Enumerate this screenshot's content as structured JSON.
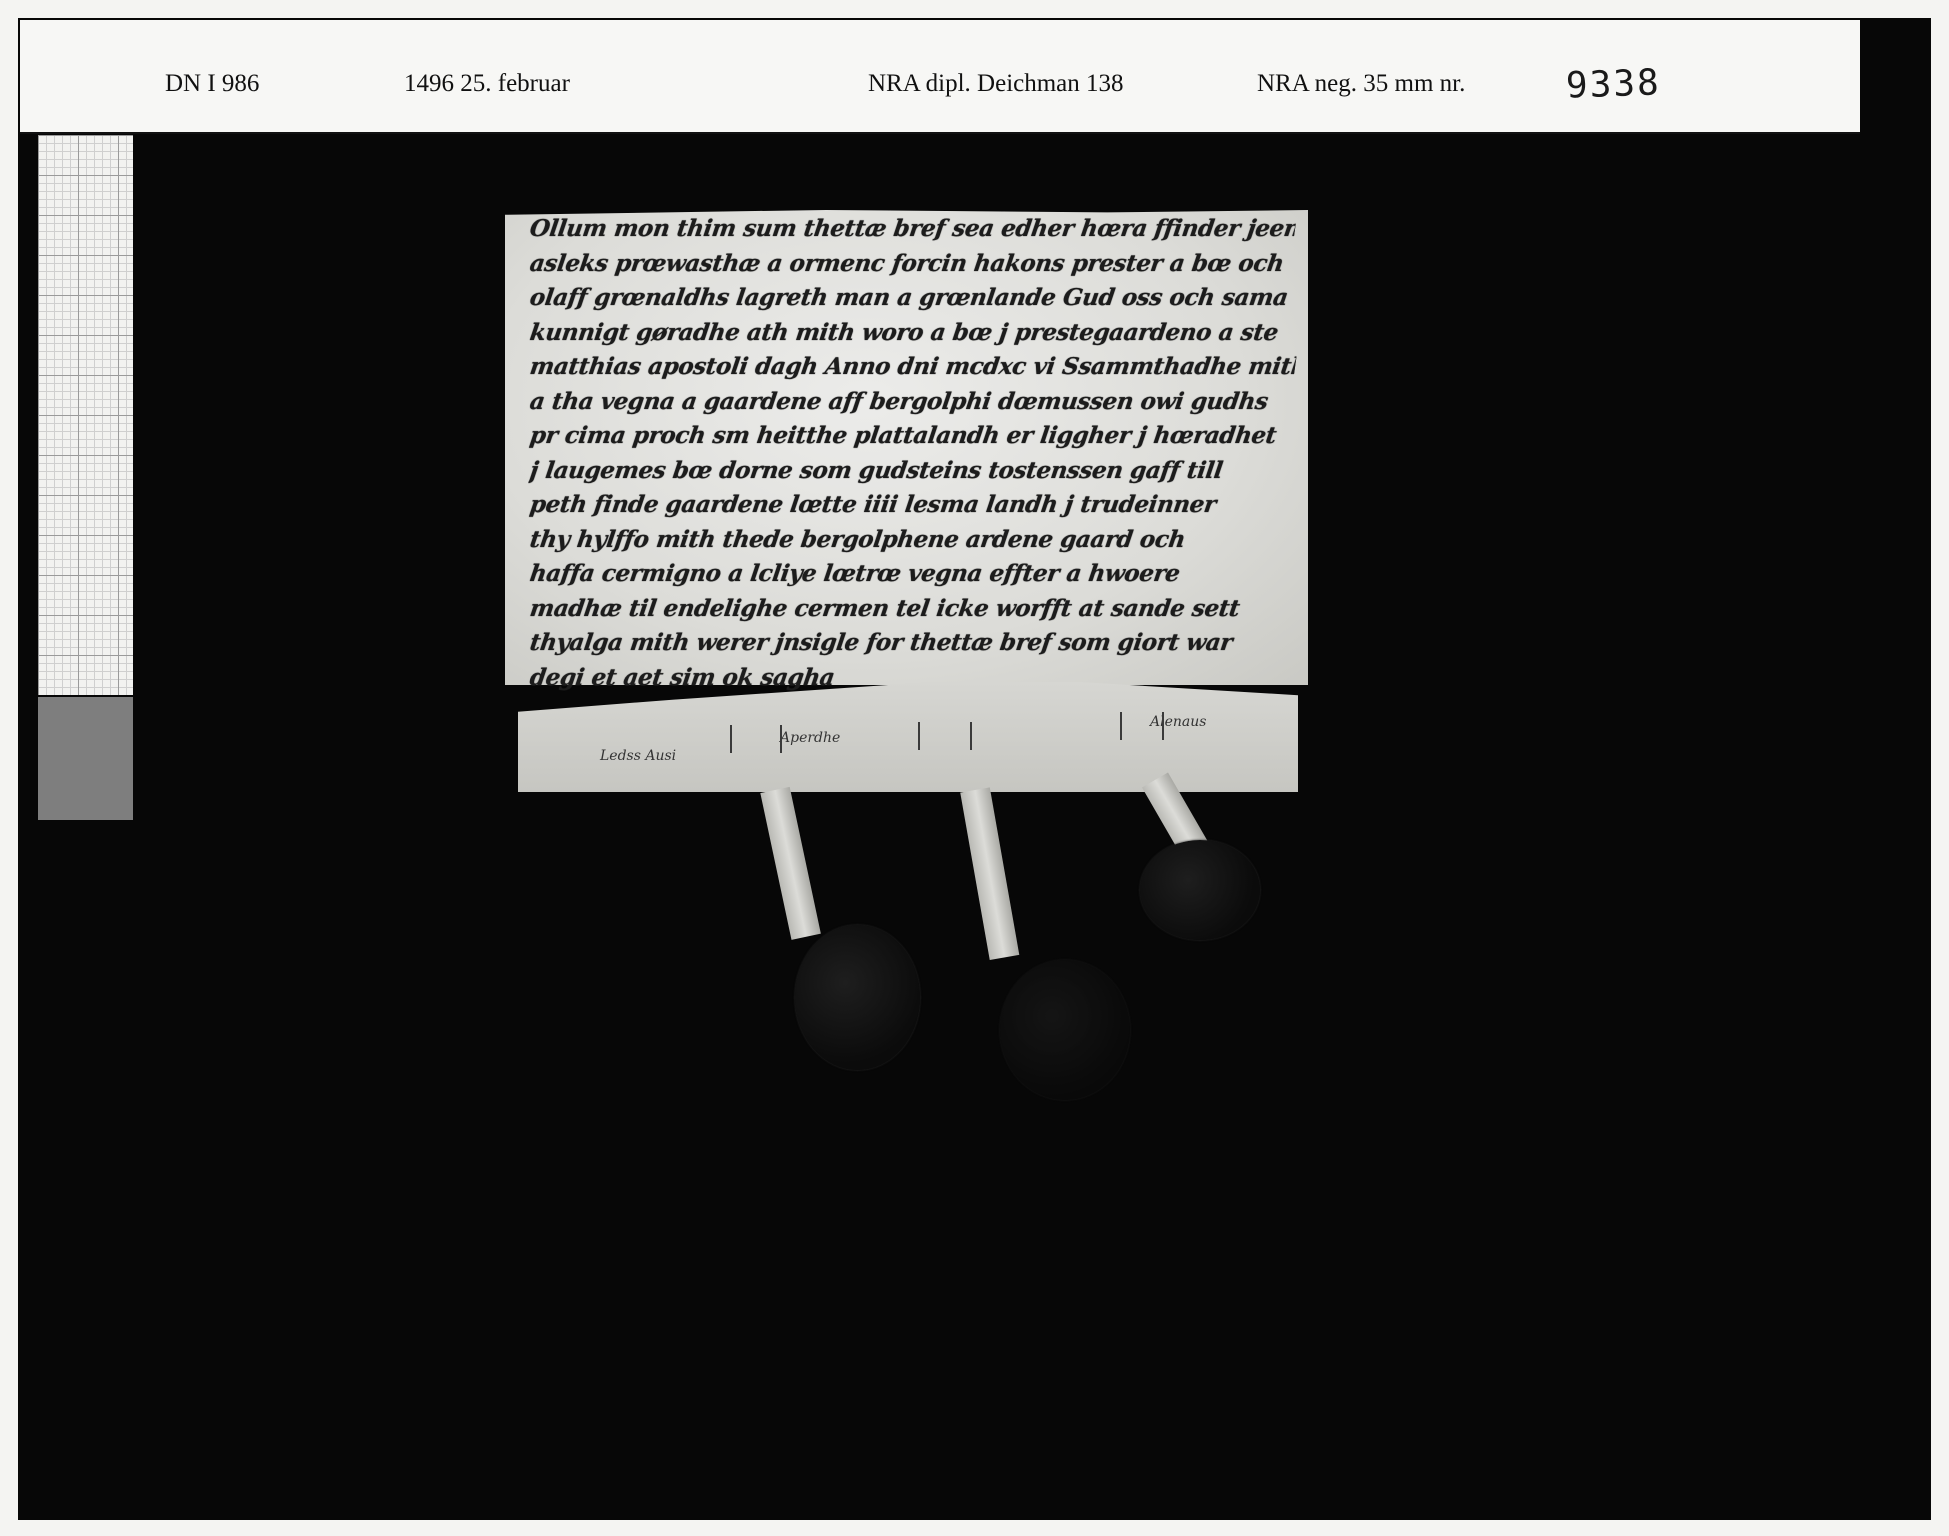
{
  "label": {
    "reference": "DN I 986",
    "date": "1496  25. februar",
    "archive": "NRA dipl. Deichman 138",
    "negative": "NRA neg. 35 mm nr.",
    "negative_number": "9338"
  },
  "document": {
    "lines": [
      "Ollum mon thim sum thettæ bref sea edher hœra ffinder jeen",
      "asleks prœwasthæ a ormenc forcin hakons prester a bœ och",
      "olaff grœnaldhs lagreth man a grœnlande Gud oss och sama",
      "kunnigt gøradhe ath mith woro a bœ j prestegaardeno a ste",
      "matthias apostoli dagh Anno dni mcdxc vi Ssammthadhe mith",
      "a tha vegna a gaardene aff bergolphi dœmussen owi gudhs",
      "pr cima proch sm heitthe plattalandh er liggher j hœradhet",
      "j laugemes bœ dorne som gudsteins tostenssen gaff till",
      "peth finde gaardene lœtte iiii lesma landh j trudeinner",
      "thy hylffo mith thede bergolphene ardene gaard och",
      "haffa cermigno a lcliye lœtrœ vegna effter a hwoere",
      "madhæ til endelighe cermen tel icke worfft at sande sett",
      "thyalga mith werer jnsigle for thettæ bref som giort war",
      "degi et aet sim ok sagha"
    ],
    "fold_notes": [
      "Ledss Ausi",
      "Aperdhe",
      "Alenaus"
    ]
  }
}
